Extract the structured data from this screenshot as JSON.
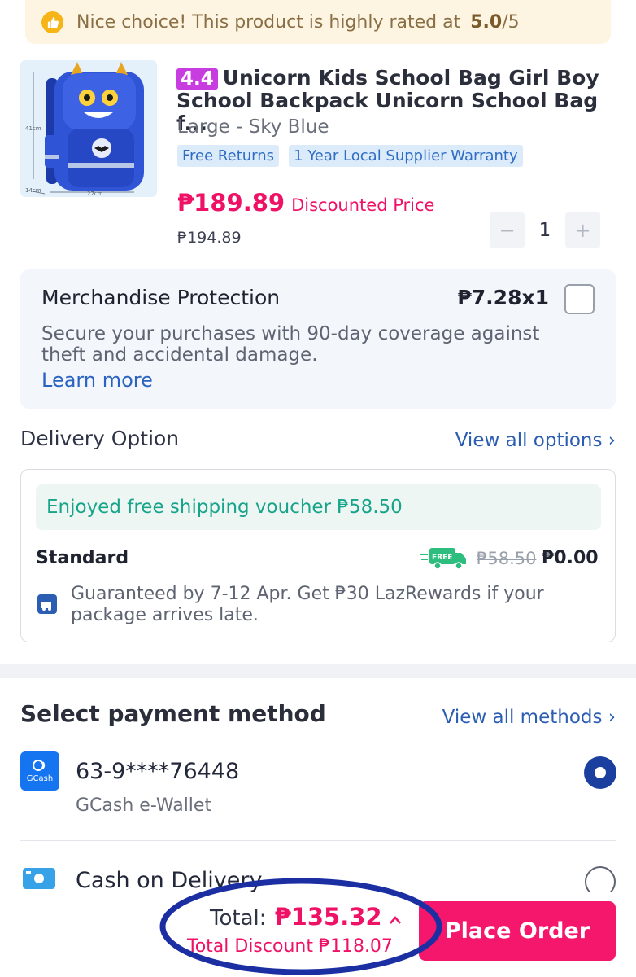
{
  "banner": {
    "icon": "thumbs-up-icon",
    "text": "Nice choice! This product is highly rated at",
    "rating": "5.0",
    "rating_denominator": "/5"
  },
  "product": {
    "rating_badge": "4.4",
    "title": "Unicorn Kids School Bag Girl Boy School Backpack Unicorn School Bag f...",
    "variant": "Large - Sky Blue",
    "tags": [
      "Free Returns",
      "1 Year Local Supplier Warranty"
    ],
    "price": "₱189.89",
    "price_label": "Discounted Price",
    "original_price": "₱194.89",
    "image_dimensions": [
      "41cm",
      "14cm",
      "27cm"
    ],
    "quantity": "1",
    "minus": "−",
    "plus": "+"
  },
  "protection": {
    "title": "Merchandise Protection",
    "price": "₱7.28x1",
    "description": "Secure your purchases with 90-day coverage against theft and accidental damage.",
    "learn_more": "Learn more",
    "checked": false
  },
  "delivery": {
    "title": "Delivery Option",
    "view_all": "View all options ›",
    "voucher": "Enjoyed free shipping voucher ₱58.50",
    "method": "Standard",
    "free_badge": "FREE",
    "old_fee": "₱58.50",
    "new_fee": "₱0.00",
    "guarantee": "Guaranteed by 7-12 Apr. Get ₱30 LazRewards if your package arrives late."
  },
  "payment": {
    "title": "Select payment method",
    "view_all": "View all methods ›",
    "methods": [
      {
        "logo_text": "GCash",
        "label": "63-9****76448",
        "sublabel": "GCash e-Wallet",
        "selected": true,
        "icon": "gcash-icon"
      },
      {
        "label": "Cash on Delivery",
        "selected": false,
        "icon": "cash-icon"
      }
    ]
  },
  "footer": {
    "total_label": "Total:",
    "total": "₱135.32",
    "caret": "^",
    "discount": "Total Discount ₱118.07",
    "place_order": "Place Order"
  },
  "colors": {
    "accent": "#ee1166",
    "link": "#2b5db3",
    "annotation_ring": "#1b2fa3"
  }
}
